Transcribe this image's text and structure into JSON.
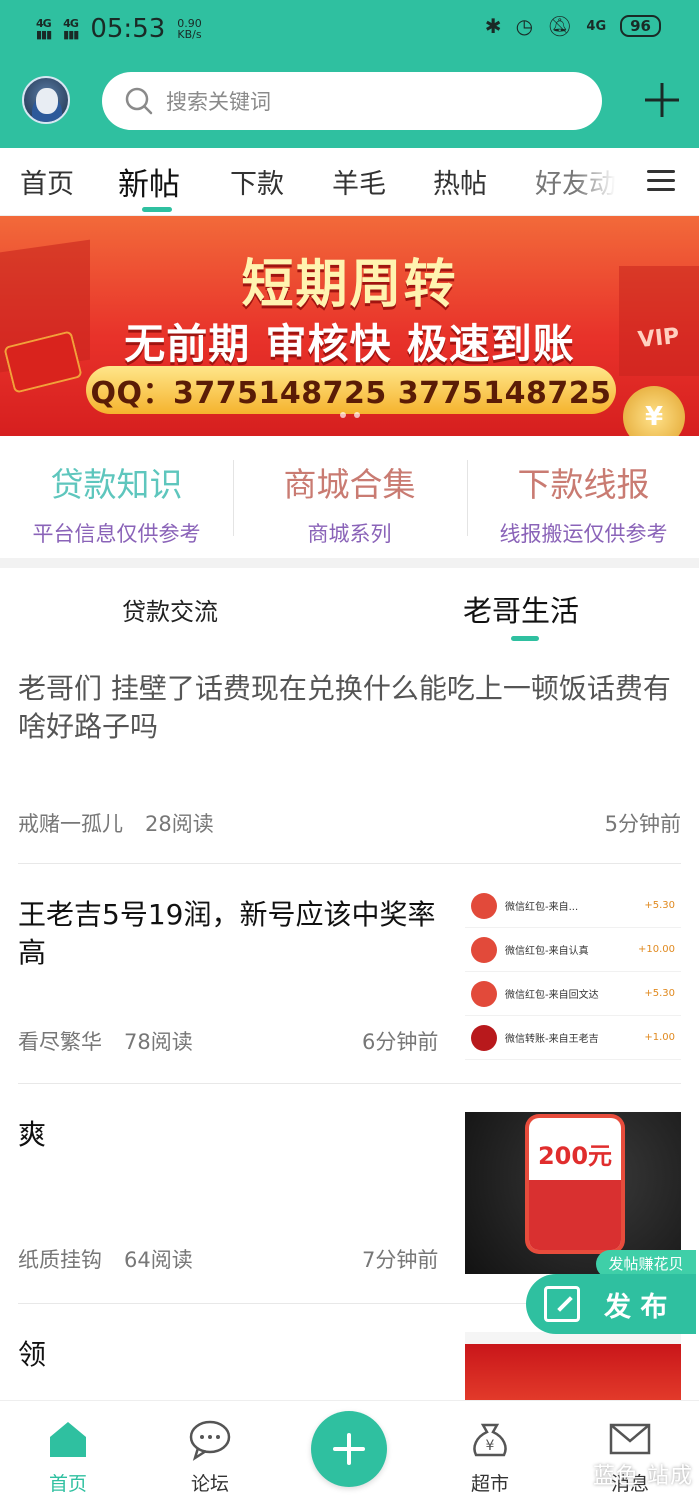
{
  "status_bar": {
    "signal1": "4G",
    "signal2": "4G",
    "time": "05:53",
    "speed": "0.90",
    "speed_unit": "KB/s",
    "net": "4G",
    "battery": "96"
  },
  "search": {
    "placeholder": "搜索关键词"
  },
  "tabs": [
    "首页",
    "新帖",
    "下款",
    "羊毛",
    "热帖",
    "好友动"
  ],
  "active_tab": "新帖",
  "banner": {
    "title": "短期周转",
    "subtitle": "无前期  审核快  极速到账",
    "contact": "QQ：3775148725  3775148725",
    "badge": "VIP",
    "coin": "¥"
  },
  "quick_links": [
    {
      "title": "贷款知识",
      "subtitle": "平台信息仅供参考",
      "color": "#5ec6bd"
    },
    {
      "title": "商城合集",
      "subtitle": "商城系列",
      "color": "#c97b72"
    },
    {
      "title": "下款线报",
      "subtitle": "线报搬运仅供参考",
      "color": "#c97b72"
    }
  ],
  "sub_tabs": [
    "贷款交流",
    "老哥生活"
  ],
  "active_sub_tab": "老哥生活",
  "posts": [
    {
      "title": "老哥们 挂壁了话费现在兑换什么能吃上一顿饭话费有啥好路子吗",
      "author": "戒赌一孤儿",
      "reads": "28阅读",
      "time": "5分钟前"
    },
    {
      "title": "王老吉5号19润，新号应该中奖率高",
      "author": "看尽繁华",
      "reads": "78阅读",
      "time": "6分钟前",
      "thumb_rows": [
        {
          "label": "微信红包-来自...",
          "amount": "+5.30"
        },
        {
          "label": "微信红包-来自认真",
          "amount": "+10.00"
        },
        {
          "label": "微信红包-来自回文达",
          "amount": "+5.30"
        },
        {
          "label": "微信转账-来自王老吉",
          "amount": "+1.00"
        }
      ]
    },
    {
      "title": "爽",
      "author": "纸质挂钩",
      "reads": "64阅读",
      "time": "7分钟前",
      "thumb_value": "200元"
    },
    {
      "title": "领"
    }
  ],
  "float_button": {
    "tip": "发帖赚花贝",
    "label": "发 布"
  },
  "bottom_nav": [
    {
      "label": "首页",
      "icon": "home-icon"
    },
    {
      "label": "论坛",
      "icon": "chat-icon"
    },
    {
      "label": "",
      "icon": "add-icon"
    },
    {
      "label": "超市",
      "icon": "money-bag-icon"
    },
    {
      "label": "消息",
      "icon": "mail-icon"
    }
  ],
  "watermark": "蓝色 站成",
  "colors": {
    "accent": "#2fc0a0",
    "banner_red": "#e8322a"
  }
}
